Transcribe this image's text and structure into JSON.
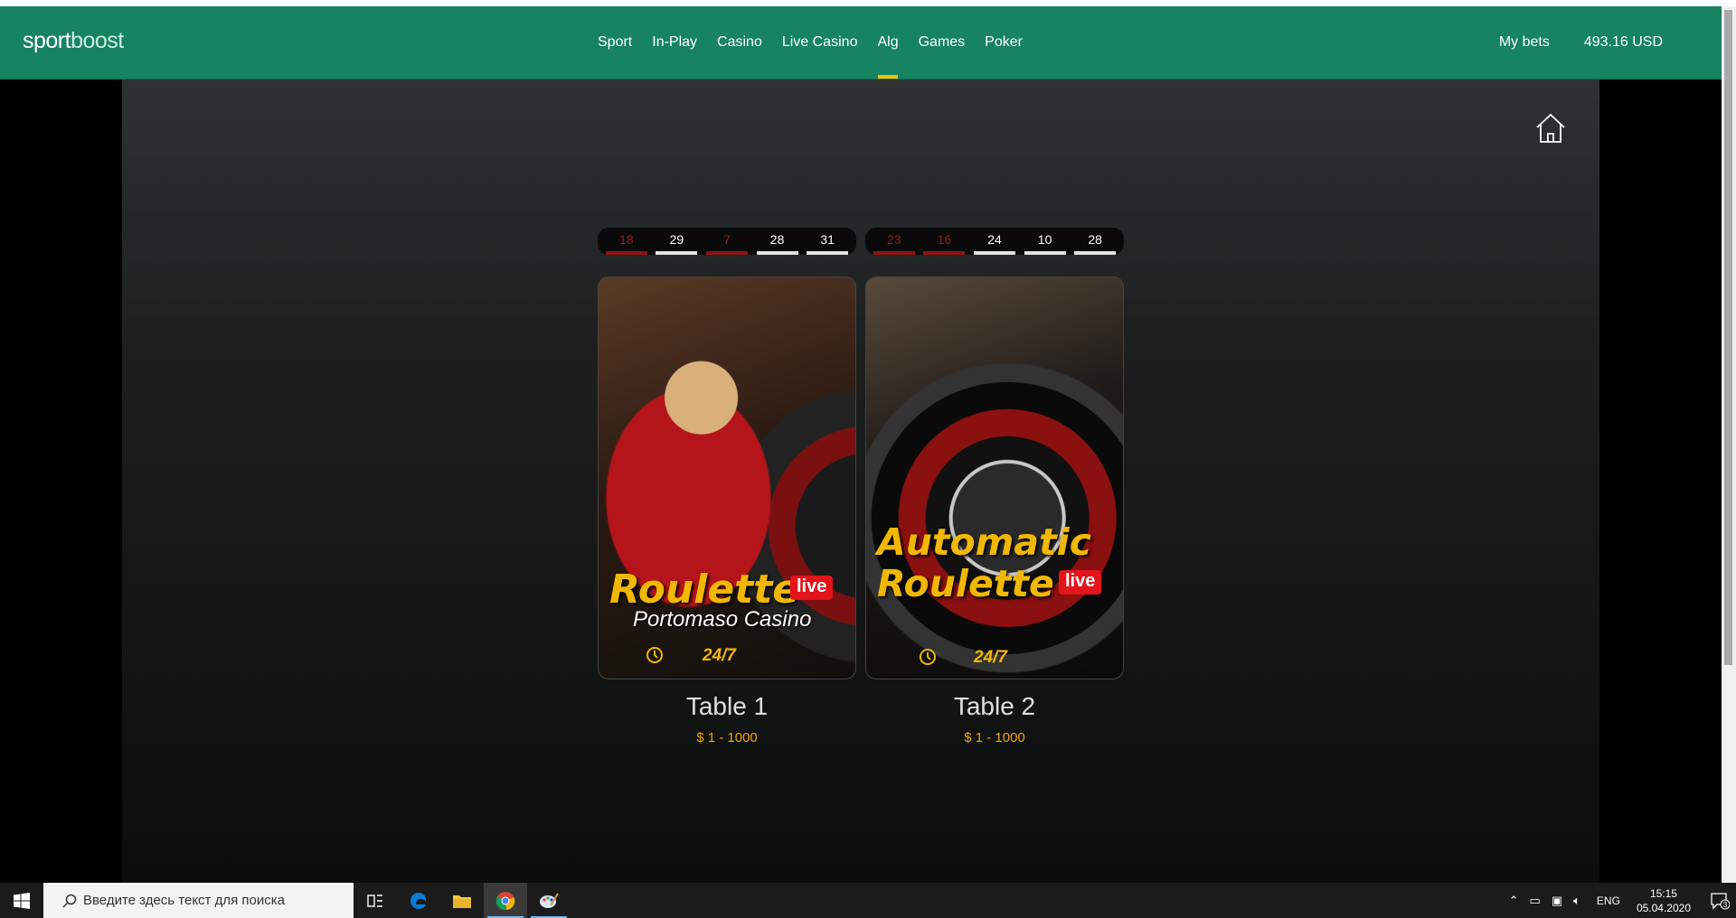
{
  "header": {
    "logo": {
      "part1": "sport",
      "part2": "boost"
    },
    "nav": [
      "Sport",
      "In-Play",
      "Casino",
      "Live Casino",
      "Alg",
      "Games",
      "Poker"
    ],
    "active_nav": "Alg",
    "my_bets": "My bets",
    "balance": "493.16 USD"
  },
  "games": [
    {
      "history": [
        {
          "value": "18",
          "color": "red"
        },
        {
          "value": "29",
          "color": "black"
        },
        {
          "value": "7",
          "color": "red"
        },
        {
          "value": "28",
          "color": "black"
        },
        {
          "value": "31",
          "color": "black"
        }
      ],
      "card_title": "Roulette",
      "live_badge": "live",
      "card_subtitle": "Portomaso Casino",
      "hours": "24/7",
      "name": "Table 1",
      "limits": "$ 1 - 1000"
    },
    {
      "history": [
        {
          "value": "23",
          "color": "red"
        },
        {
          "value": "16",
          "color": "red"
        },
        {
          "value": "24",
          "color": "black"
        },
        {
          "value": "10",
          "color": "black"
        },
        {
          "value": "28",
          "color": "black"
        }
      ],
      "card_title_line1": "Automatic",
      "card_title_line2": "Roulette",
      "live_badge": "live",
      "hours": "24/7",
      "name": "Table 2",
      "limits": "$ 1 - 1000"
    }
  ],
  "taskbar": {
    "search_placeholder": "Введите здесь текст для поиска",
    "apps": [
      "task-view-icon",
      "edge-icon",
      "file-explorer-icon",
      "chrome-icon",
      "paint-icon"
    ],
    "language": "ENG",
    "time": "15:15",
    "date": "05.04.2020",
    "notification_count": "3"
  },
  "colors": {
    "header_bg": "#168361",
    "accent_yellow": "#f2b800",
    "live_red": "#e4141b",
    "limits_orange": "#f0a800"
  }
}
